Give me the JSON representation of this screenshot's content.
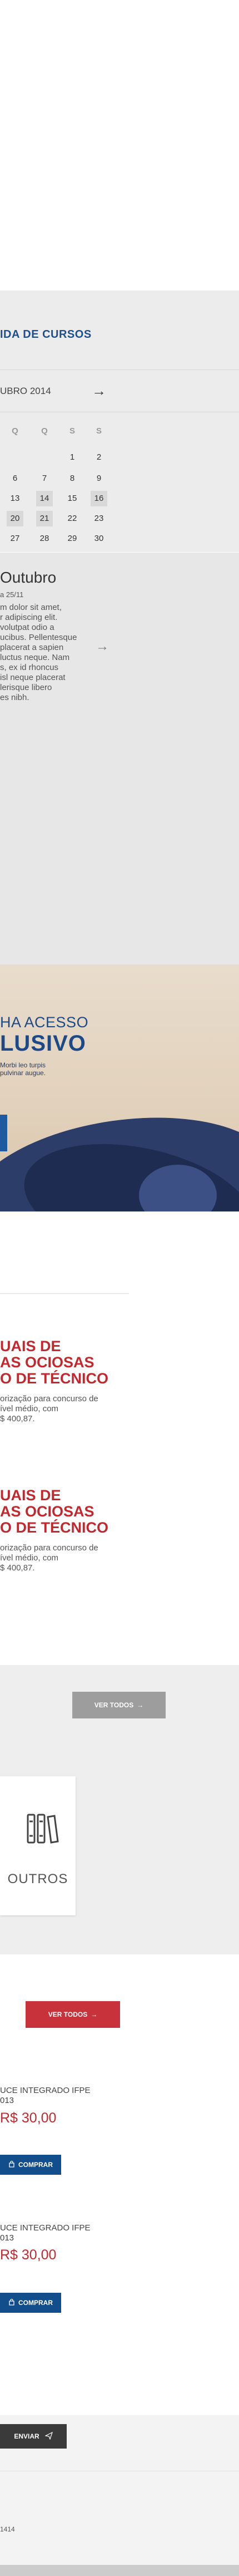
{
  "agenda": {
    "title": "IDA DE CURSOS",
    "month": "UBRO 2014",
    "next_icon": "arrow-right-icon",
    "weekdays": [
      "Q",
      "Q",
      "S",
      "S"
    ],
    "weeks": [
      [
        "",
        "",
        "1",
        "2"
      ],
      [
        "6",
        "7",
        "8",
        "9"
      ],
      [
        "13",
        "14",
        "15",
        "16"
      ],
      [
        "20",
        "21",
        "22",
        "23"
      ],
      [
        "27",
        "28",
        "29",
        "30"
      ]
    ],
    "highlighted": [
      "14",
      "16",
      "20",
      "21"
    ]
  },
  "event": {
    "title": "Outubro",
    "date": "a 25/11",
    "text_lines": [
      "m dolor sit amet,",
      "r adipiscing elit.",
      "volutpat odio a",
      "ucibus. Pellentesque",
      "placerat a sapien",
      "luctus neque. Nam",
      "s, ex id rhoncus",
      "isl neque placerat",
      "lerisque libero",
      "es nibh."
    ],
    "arrow_icon": "arrow-right-icon"
  },
  "banner": {
    "line1": "HA ACESSO",
    "line2": "LUSIVO",
    "sub_lines": [
      "Morbi leo turpis",
      "pulvinar augue."
    ]
  },
  "news": [
    {
      "title_lines": [
        "UAIS DE",
        "AS OCIOSAS",
        "O DE TÉCNICO"
      ],
      "text_lines": [
        "orização para concurso de",
        "ível médio, com",
        "$ 400,87."
      ]
    },
    {
      "title_lines": [
        "UAIS DE",
        "AS OCIOSAS",
        "O DE TÉCNICO"
      ],
      "text_lines": [
        "orização para concurso de",
        "ível médio, com",
        "$ 400,87."
      ]
    }
  ],
  "see_all_gray": {
    "label": "VER TODOS",
    "icon": "arrow-right-icon"
  },
  "category_card": {
    "label": "OUTROS",
    "icon": "books-icon"
  },
  "see_all_red": {
    "label": "VER TODOS",
    "icon": "arrow-right-icon"
  },
  "products": [
    {
      "title_lines": [
        "UCE INTEGRADO IFPE",
        "013"
      ],
      "price": "R$ 30,00",
      "buy_label": "COMPRAR",
      "buy_icon": "shopping-bag-icon"
    },
    {
      "title_lines": [
        "UCE INTEGRADO IFPE",
        "013"
      ],
      "price": "R$ 30,00",
      "buy_label": "COMPRAR",
      "buy_icon": "shopping-bag-icon"
    }
  ],
  "send_button": {
    "label": "ENVIAR",
    "icon": "paper-plane-icon"
  },
  "footer": {
    "text": "1414"
  },
  "colors": {
    "brand_blue": "#1e4f8c",
    "brand_red": "#c4282f",
    "buy_blue": "#124d8c"
  }
}
